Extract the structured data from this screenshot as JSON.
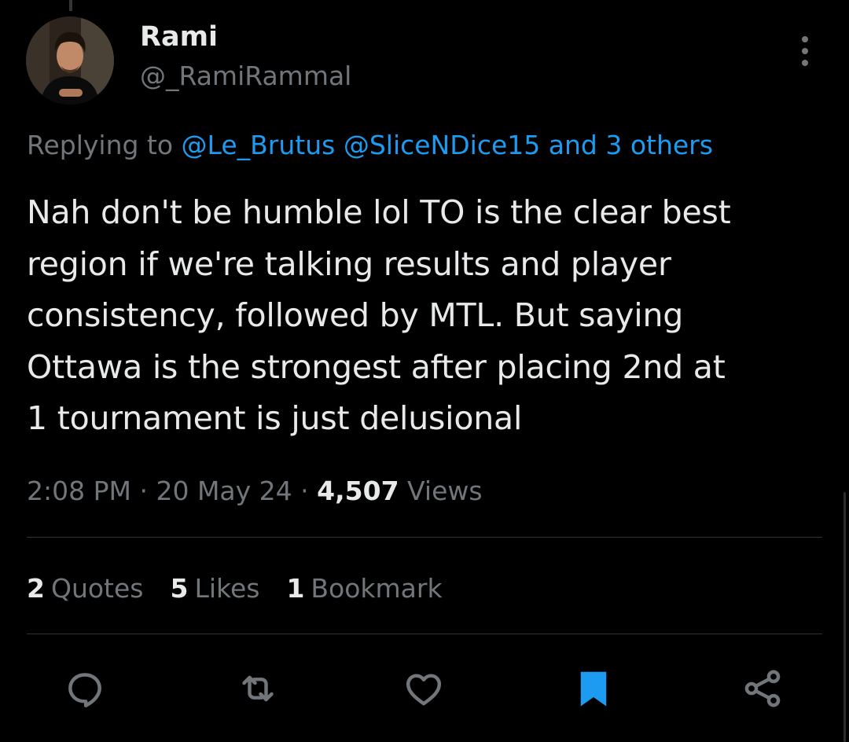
{
  "author": {
    "display_name": "Rami",
    "handle": "@_RamiRammal"
  },
  "reply_context": {
    "prefix": "Replying to",
    "mention_1": "@Le_Brutus",
    "mention_2": "@SliceNDice15",
    "others": "and 3 others"
  },
  "tweet": {
    "text": "Nah don't be humble lol TO is the clear best\nregion if we're talking results and player\nconsistency, followed by MTL. But saying\nOttawa is the strongest after placing 2nd at\n1 tournament is just delusional",
    "time": "2:08 PM",
    "date": "20 May 24",
    "views_count": "4,507",
    "views_label": "Views"
  },
  "stats": {
    "quotes_count": "2",
    "quotes_label": "Quotes",
    "likes_count": "5",
    "likes_label": "Likes",
    "bookmarks_count": "1",
    "bookmarks_label": "Bookmark"
  },
  "actions": [
    {
      "icon": "reply-icon"
    },
    {
      "icon": "retweet-icon"
    },
    {
      "icon": "heart-icon"
    },
    {
      "icon": "bookmark-icon",
      "active": true
    },
    {
      "icon": "share-icon"
    }
  ],
  "colors": {
    "background": "#000000",
    "text": "#e7e9ea",
    "secondary": "#71767b",
    "accent": "#1d9bf0",
    "divider": "#2f3336"
  }
}
